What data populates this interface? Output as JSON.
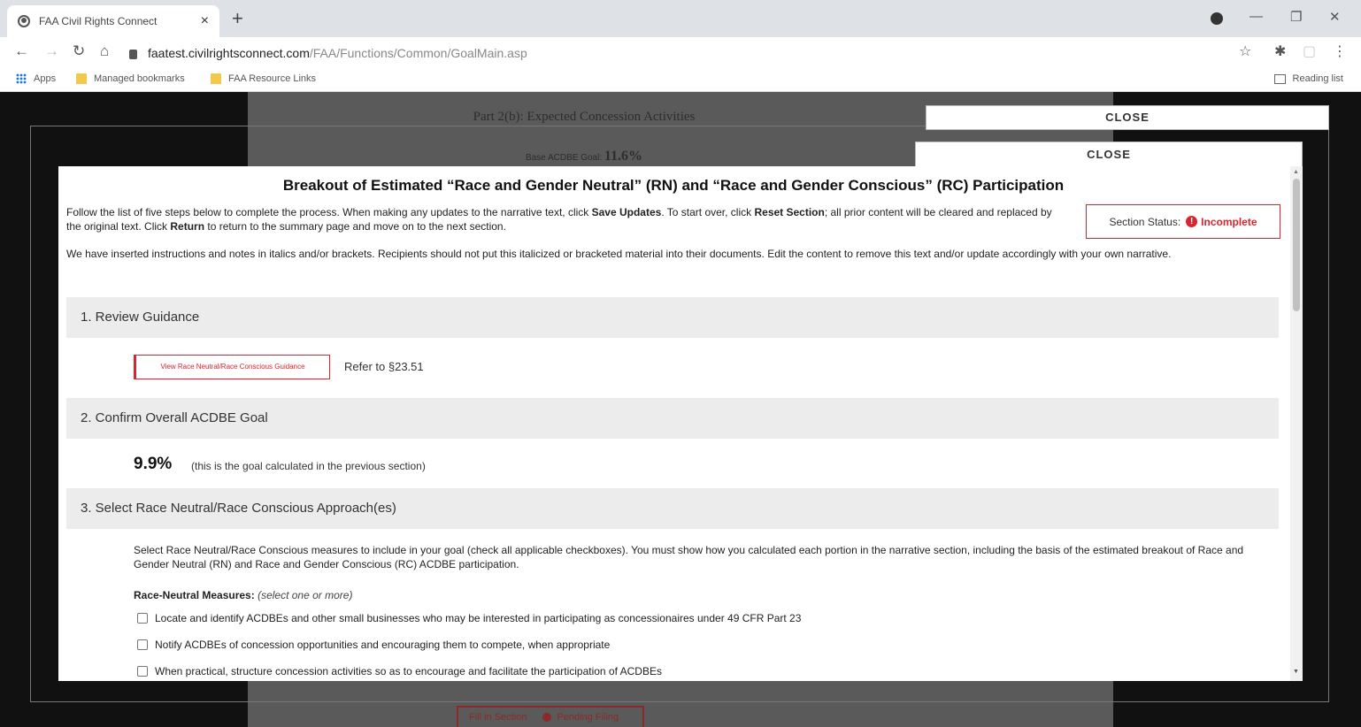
{
  "browser": {
    "tab_title": "FAA Civil Rights Connect",
    "tab_close": "×",
    "new_tab": "+",
    "url_host": "faatest.civilrightsconnect.com",
    "url_path": "/FAA/Functions/Common/GoalMain.asp",
    "bookmarks": [
      "Apps",
      "Managed bookmarks",
      "FAA Resource Links"
    ],
    "reading_list": "Reading list"
  },
  "background": {
    "heading": "Part 2(b): Expected Concession Activities",
    "goal_label": "Base ACDBE Goal:",
    "goal_value": "11.6%",
    "footer_button": "Fill in Section",
    "footer_status": "Pending Filing"
  },
  "overlays": {
    "close1": "CLOSE",
    "close2": "CLOSE"
  },
  "modal": {
    "title": "Breakout of Estimated “Race and Gender Neutral” (RN) and “Race and Gender Conscious” (RC) Participation",
    "intro1_a": "Follow the list of five steps below to complete the process. When making any updates to the narrative text, click ",
    "intro1_save": "Save Updates",
    "intro1_b": ". To start over, click ",
    "intro1_reset": "Reset Section",
    "intro1_c": "; all prior content will be cleared and replaced by the original text. Click ",
    "intro1_return": "Return",
    "intro1_d": " to return to the summary page and move on to the next section.",
    "intro2": "We have inserted instructions and notes in italics and/or brackets. Recipients should not put this italicized or bracketed material into their documents. Edit the content to remove this text and/or update accordingly with your own narrative.",
    "status_label": "Section Status:",
    "status_value": "Incomplete",
    "sections": {
      "s1": "1. Review Guidance",
      "s2": "2. Confirm Overall ACDBE Goal",
      "s3": "3. Select Race Neutral/Race Conscious Approach(es)"
    },
    "guidance_button": "View Race Neutral/Race Conscious Guidance",
    "refer": "Refer to §23.51",
    "goal_value": "9.9%",
    "goal_note": "(this is the goal calculated in the previous section)",
    "s3_text": "Select Race Neutral/Race Conscious measures to include in your goal (check all applicable checkboxes). You must show how you calculated each portion in the narrative section, including the basis of the estimated breakout of Race and Gender Neutral (RN) and Race and Gender Conscious (RC) ACDBE participation.",
    "rn_label": "Race-Neutral Measures:",
    "rn_hint": "(select one or more)",
    "checkboxes": [
      "Locate and identify ACDBEs and other small businesses who may be interested in participating as concessionaires under 49 CFR Part 23",
      "Notify ACDBEs of concession opportunities and encouraging them to compete, when appropriate",
      "When practical, structure concession activities so as to encourage and facilitate the participation of ACDBEs"
    ]
  }
}
